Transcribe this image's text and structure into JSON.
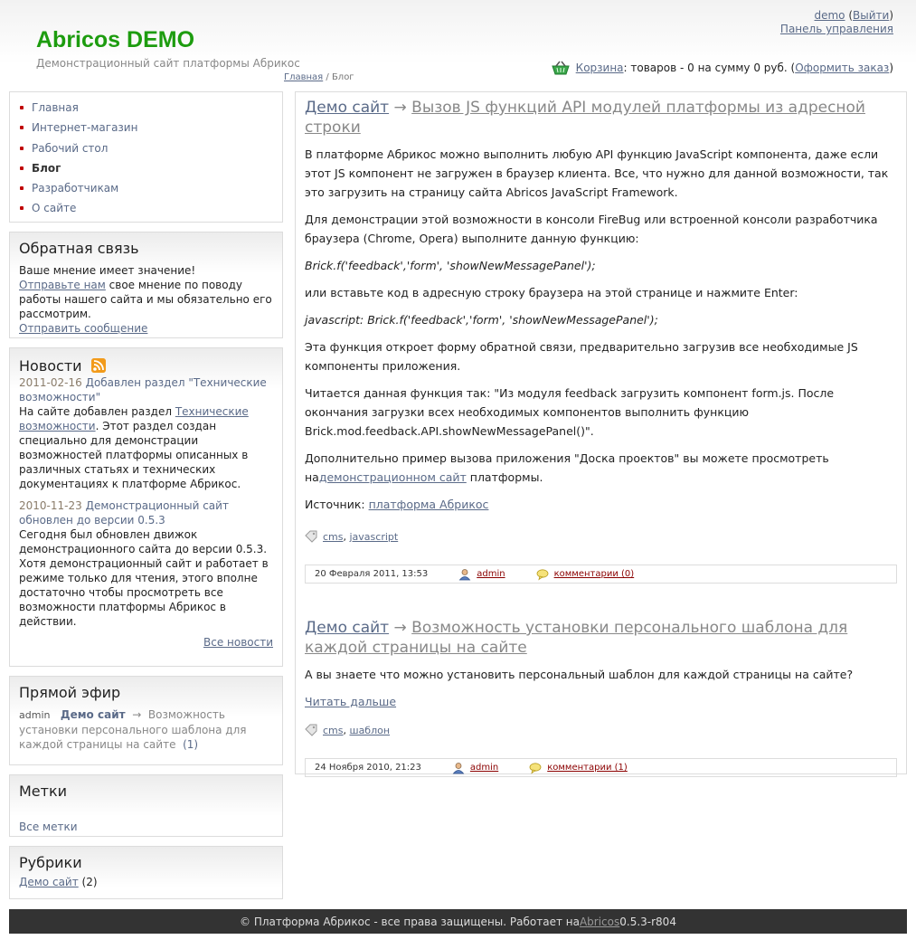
{
  "header": {
    "site_title": "Abricos DEMO",
    "site_subtitle": "Демонстрационный сайт платформы Абрикос",
    "breadcrumb": {
      "home": "Главная",
      "sep": " / ",
      "current": "Блог"
    },
    "user": {
      "name": "demo",
      "logout": "Выйти",
      "control_panel": "Панель управления"
    },
    "cart": {
      "link": "Корзина",
      "text": ": товаров - 0 на сумму 0 руб. (",
      "order": "Оформить заказ",
      "close": ")"
    }
  },
  "sidebar": {
    "menu": [
      {
        "label": "Главная"
      },
      {
        "label": "Интернет-магазин"
      },
      {
        "label": "Рабочий стол"
      },
      {
        "label": "Блог",
        "active": true
      },
      {
        "label": "Разработчикам"
      },
      {
        "label": "О сайте"
      }
    ],
    "feedback": {
      "title": "Обратная связь",
      "line1": "Ваше мнение имеет значение!",
      "link": "Отправьте нам",
      "text": " свое мнение по поводу работы нашего сайта и мы обязательно его рассмотрим.",
      "send": "Отправить сообщение"
    },
    "news": {
      "title": "Новости",
      "items": [
        {
          "date": "2011-02-16",
          "title": " Добавлен раздел \"Технические возможности\"",
          "body_pre": "На сайте добавлен раздел ",
          "body_link": "Технические возможности",
          "body_post": ". Этот раздел создан специально для демонстрации возможностей платформы описанных в различных статьях и технических документациях к платформе Абрикос."
        },
        {
          "date": "2010-11-23",
          "title": " Демонстрационный сайт обновлен до версии 0.5.3",
          "body": "Сегодня был обновлен движок демонстрационного сайта до версии 0.5.3. Хотя демонстрационный сайт и работает в режиме только для чтения, этого вполне достаточно чтобы просмотреть все возможности платформы Абрикос в действии."
        }
      ],
      "all": "Все новости"
    },
    "live": {
      "title": "Прямой эфир",
      "author": "admin",
      "site": "Демо сайт",
      "arrow": "→",
      "topic": "Возможность установки персонального шаблона для каждой страницы на сайте",
      "count": "(1)"
    },
    "tags": {
      "title": "Метки",
      "all": "Все метки"
    },
    "rubrics": {
      "title": "Рубрики",
      "item": "Демо сайт",
      "count": " (2)"
    }
  },
  "posts": [
    {
      "category": "Демо сайт",
      "arrow": " → ",
      "title": "Вызов JS функций API модулей платформы из адресной строки",
      "p1": "В платформе Абрикос можно выполнить любую API функцию JavaScript компонента, даже если этот JS компонент не загружен в браузер клиента. Все, что нужно для данной возможности, так это загрузить на страницу сайта Abricos JavaScript Framework.",
      "p2": "Для демонстрации этой возможности в консоли FireBug или встроенной консоли разработчика браузера (Chrome, Opera) выполните данную функцию:",
      "code1": "Brick.f('feedback','form', 'showNewMessagePanel');",
      "p3": "или вставьте код в адресную строку браузера на этой странице и нажмите Enter:",
      "code2": "javascript: Brick.f('feedback','form', 'showNewMessagePanel');",
      "p4": "Эта функция откроет форму обратной связи, предварительно загрузив все необходимые JS компоненты приложения.",
      "p5": "Читается данная функция так: \"Из модуля feedback загрузить компонент form.js. После окончания загрузки всех необходимых компонентов выполнить функцию Brick.mod.feedback.API.showNewMessagePanel()\".",
      "p6_pre": "Дополнительно пример вызова приложения \"Доска проектов\" вы можете просмотреть на",
      "p6_link": "демонстрационном сайт",
      "p6_post": " платформы.",
      "source_label": "Источник: ",
      "source_link": "платформа Абрикос",
      "tags": [
        "cms",
        "javascript"
      ],
      "date": "20 Февраля 2011, 13:53",
      "author": "admin",
      "comments": "комментарии (0)"
    },
    {
      "category": "Демо сайт",
      "arrow": " → ",
      "title": "Возможность установки персонального шаблона для каждой страницы на сайте",
      "p1": "А вы знаете что можно установить персональный шаблон для каждой страницы на сайте?",
      "more": "Читать дальше",
      "tags": [
        "cms",
        "шаблон"
      ],
      "date": "24 Ноября 2010, 21:23",
      "author": "admin",
      "comments": "комментарии (1)"
    }
  ],
  "footer": {
    "text": "© Платформа Абрикос - все права защищены. Работает на ",
    "link": "Abricos",
    "version": " 0.5.3-r804"
  }
}
